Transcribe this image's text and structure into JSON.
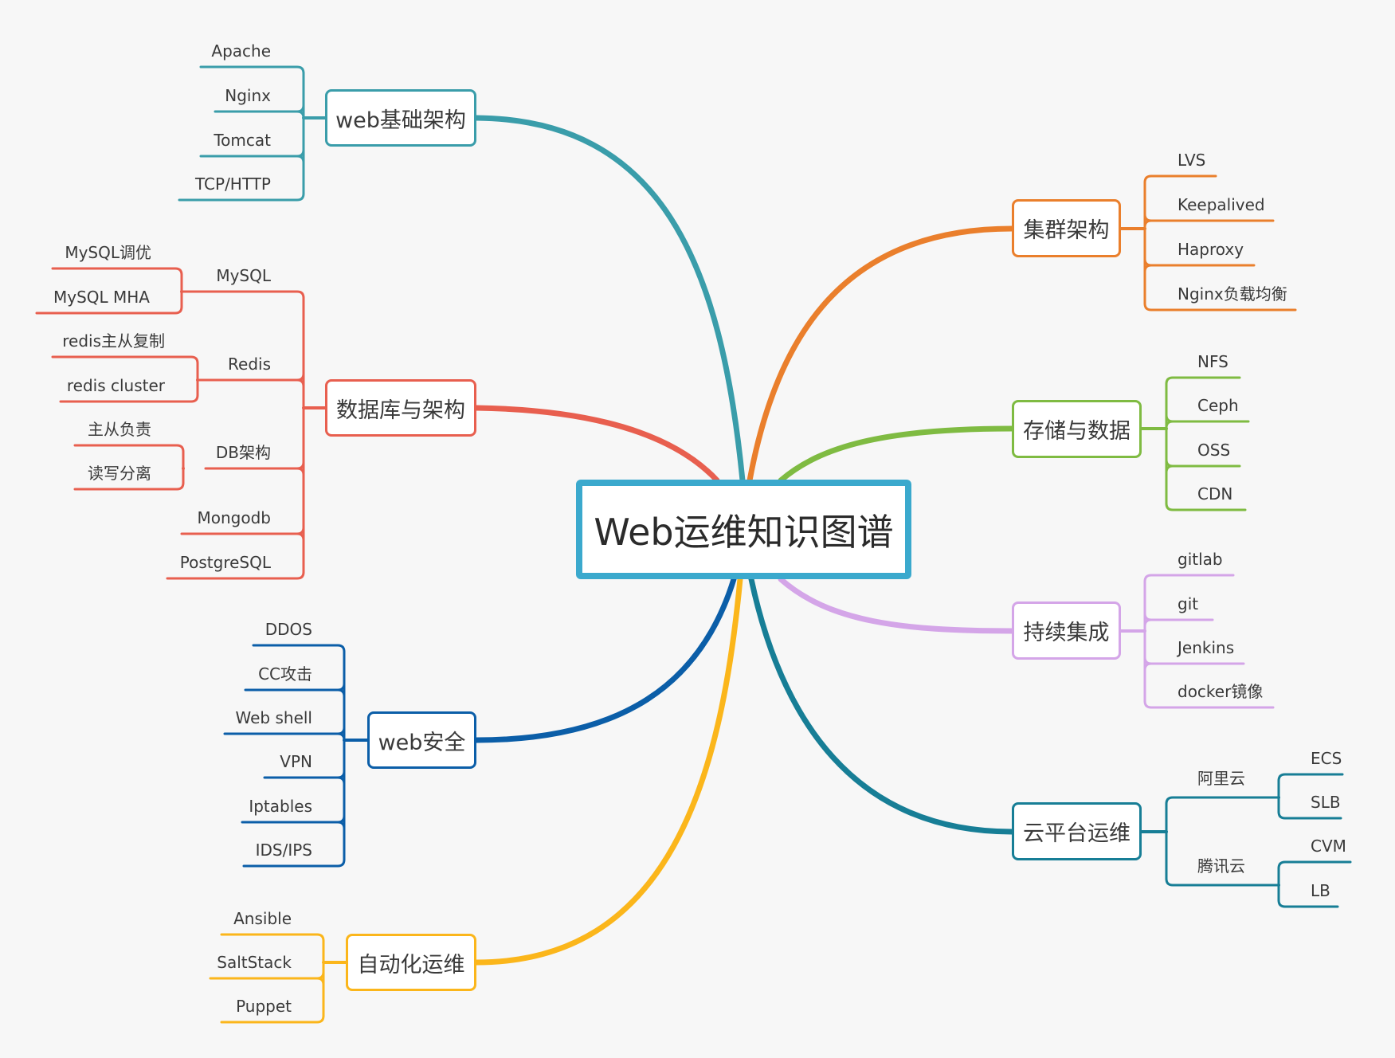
{
  "center": {
    "label": "Web运维知识图谱",
    "color": "#3ba9cd"
  },
  "branches": [
    {
      "id": "web-infra",
      "label": "web基础架构",
      "color": "#3a9daa",
      "children": [
        {
          "label": "Apache"
        },
        {
          "label": "Nginx"
        },
        {
          "label": "Tomcat"
        },
        {
          "label": "TCP/HTTP"
        }
      ]
    },
    {
      "id": "database",
      "label": "数据库与架构",
      "color": "#e85f4f",
      "children": [
        {
          "label": "MySQL",
          "children": [
            {
              "label": "MySQL调优"
            },
            {
              "label": "MySQL MHA"
            }
          ]
        },
        {
          "label": "Redis",
          "children": [
            {
              "label": "redis主从复制"
            },
            {
              "label": "redis cluster"
            }
          ]
        },
        {
          "label": "DB架构",
          "children": [
            {
              "label": "主从负责"
            },
            {
              "label": "读写分离"
            }
          ]
        },
        {
          "label": "Mongodb"
        },
        {
          "label": "PostgreSQL"
        }
      ]
    },
    {
      "id": "web-security",
      "label": "web安全",
      "color": "#0b5ea8",
      "children": [
        {
          "label": "DDOS"
        },
        {
          "label": "CC攻击"
        },
        {
          "label": "Web shell"
        },
        {
          "label": "VPN"
        },
        {
          "label": "Iptables"
        },
        {
          "label": "IDS/IPS"
        }
      ]
    },
    {
      "id": "automation",
      "label": "自动化运维",
      "color": "#fbb61b",
      "children": [
        {
          "label": "Ansible"
        },
        {
          "label": "SaltStack"
        },
        {
          "label": "Puppet"
        }
      ]
    },
    {
      "id": "cluster",
      "label": "集群架构",
      "color": "#ea7f2c",
      "children": [
        {
          "label": "LVS"
        },
        {
          "label": "Keepalived"
        },
        {
          "label": "Haproxy"
        },
        {
          "label": "Nginx负载均衡"
        }
      ]
    },
    {
      "id": "storage",
      "label": "存储与数据",
      "color": "#7fbb42",
      "children": [
        {
          "label": "NFS"
        },
        {
          "label": "Ceph"
        },
        {
          "label": "OSS"
        },
        {
          "label": "CDN"
        }
      ]
    },
    {
      "id": "ci",
      "label": "持续集成",
      "color": "#d4a5e8",
      "children": [
        {
          "label": "gitlab"
        },
        {
          "label": "git"
        },
        {
          "label": "Jenkins"
        },
        {
          "label": "docker镜像"
        }
      ]
    },
    {
      "id": "cloud",
      "label": "云平台运维",
      "color": "#177e96",
      "children": [
        {
          "label": "阿里云",
          "children": [
            {
              "label": "ECS"
            },
            {
              "label": "SLB"
            }
          ]
        },
        {
          "label": "腾讯云",
          "children": [
            {
              "label": "CVM"
            },
            {
              "label": "LB"
            }
          ]
        }
      ]
    }
  ]
}
